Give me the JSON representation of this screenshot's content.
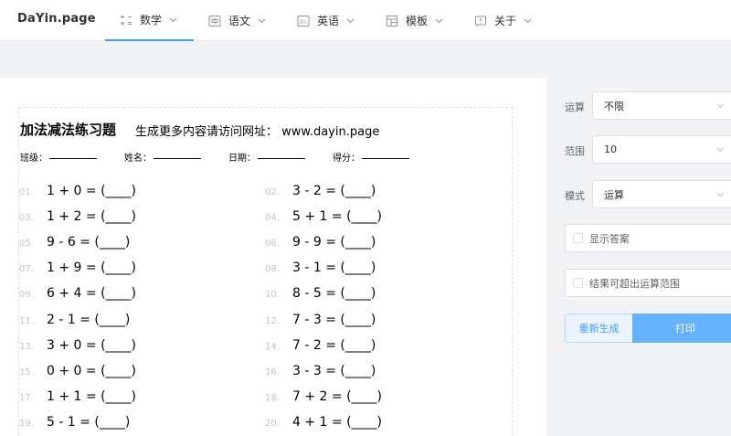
{
  "brand": "DaYin.page",
  "nav": [
    {
      "label": "数学",
      "icon": "math-symbols-icon",
      "active": true
    },
    {
      "label": "语文",
      "icon": "chinese-char-icon",
      "active": false
    },
    {
      "label": "英语",
      "icon": "english-en-icon",
      "active": false
    },
    {
      "label": "模板",
      "icon": "template-grid-icon",
      "active": false
    },
    {
      "label": "关于",
      "icon": "info-icon",
      "active": false
    }
  ],
  "worksheet": {
    "title": "加法减法练习题",
    "subtitle": "生成更多内容请访问网址： www.dayin.page",
    "fields": {
      "class": "班级：",
      "name": "姓名：",
      "date": "日期：",
      "score": "得分："
    },
    "problems": [
      {
        "num": "01.",
        "text": "1 + 0 = (____)"
      },
      {
        "num": "02.",
        "text": "3 - 2 = (____)"
      },
      {
        "num": "03.",
        "text": "1 + 2 = (____)"
      },
      {
        "num": "04.",
        "text": "5 + 1 = (____)"
      },
      {
        "num": "05.",
        "text": "9 - 6 = (____)"
      },
      {
        "num": "06.",
        "text": "9 - 9 = (____)"
      },
      {
        "num": "07.",
        "text": "1 + 9 = (____)"
      },
      {
        "num": "08.",
        "text": "3 - 1 = (____)"
      },
      {
        "num": "09.",
        "text": "6 + 4 = (____)"
      },
      {
        "num": "10.",
        "text": "8 - 5 = (____)"
      },
      {
        "num": "11.",
        "text": "2 - 1 = (____)"
      },
      {
        "num": "12.",
        "text": "7 - 3 = (____)"
      },
      {
        "num": "13.",
        "text": "3 + 0 = (____)"
      },
      {
        "num": "14.",
        "text": "7 - 2 = (____)"
      },
      {
        "num": "15.",
        "text": "0 + 0 = (____)"
      },
      {
        "num": "16.",
        "text": "3 - 3 = (____)"
      },
      {
        "num": "17.",
        "text": "1 + 1 = (____)"
      },
      {
        "num": "18.",
        "text": "7 + 2 = (____)"
      },
      {
        "num": "19.",
        "text": "5 - 1 = (____)"
      },
      {
        "num": "20.",
        "text": "4 + 1 = (____)"
      }
    ]
  },
  "settings": {
    "operation": {
      "label": "运算",
      "value": "不限"
    },
    "range": {
      "label": "范围",
      "value": "10"
    },
    "mode": {
      "label": "模式",
      "value": "运算"
    },
    "show_answer": {
      "label": "显示答案",
      "checked": false
    },
    "exceed_range": {
      "label": "结果可超出运算范围",
      "checked": false
    },
    "regenerate_label": "重新生成",
    "print_label": "打印"
  },
  "colors": {
    "accent": "#409eff",
    "print_button": "#66b1ff",
    "background": "#f2f3f5"
  }
}
